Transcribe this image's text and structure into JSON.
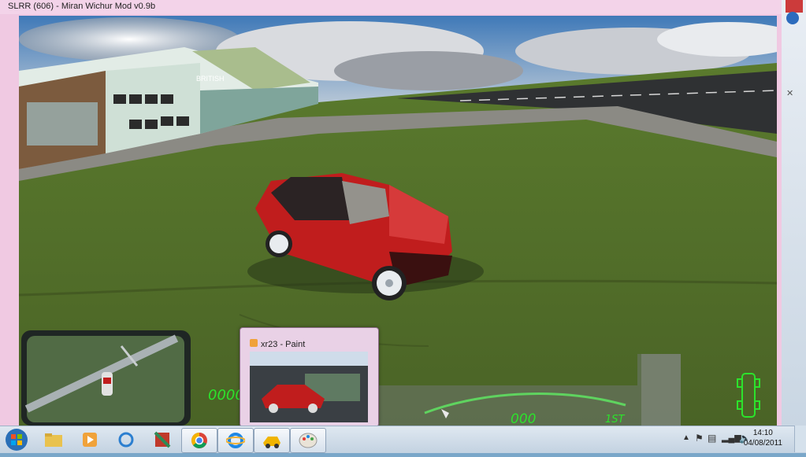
{
  "window": {
    "title": "SLRR (606) - Miran Wichur Mod v0.9b"
  },
  "hud": {
    "left_counter": "0000",
    "speed": "000",
    "gear": "1ST"
  },
  "taskbar": {
    "apps": [
      {
        "icon": "windows-start-icon"
      },
      {
        "icon": "folder-icon"
      },
      {
        "icon": "media-player-icon"
      },
      {
        "icon": "refresh-icon"
      },
      {
        "icon": "app-icon"
      },
      {
        "icon": "chrome-icon"
      },
      {
        "icon": "internet-explorer-icon"
      },
      {
        "icon": "slrr-game-icon"
      },
      {
        "icon": "paint-icon"
      }
    ],
    "time": "14:10",
    "date": "04/08/2011"
  },
  "preview": {
    "title": "xr23 - Paint"
  },
  "colors": {
    "car": "#c01d1d",
    "hud_green": "#2ce32c",
    "grass": "#4f6a26"
  }
}
